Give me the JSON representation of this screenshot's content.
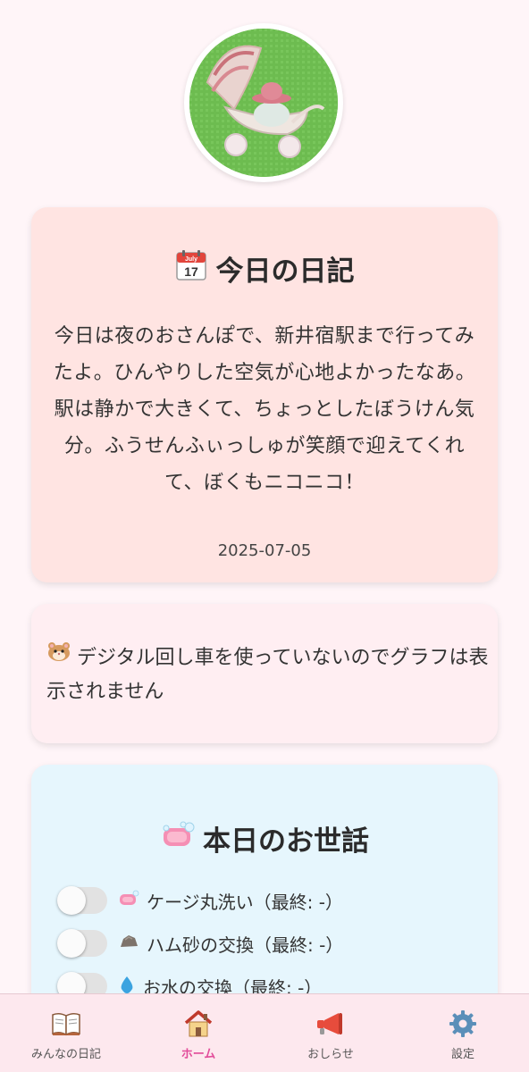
{
  "diary": {
    "title": "今日の日記",
    "calendar_icon": "calendar-icon",
    "calendar_month": "July",
    "calendar_day": "17",
    "body": "今日は夜のおさんぽで、新井宿駅まで行ってみたよ。ひんやりした空気が心地よかったなあ。駅は静かで大きくて、ちょっとしたぼうけん気分。ふうせんふぃっしゅが笑顔で迎えてくれて、ぼくもニコニコ！",
    "date": "2025-07-05"
  },
  "graph": {
    "icon": "hamster-icon",
    "message": "デジタル回し車を使っていないのでグラフは表示されません"
  },
  "care": {
    "title": "本日のお世話",
    "icon": "soap-icon",
    "items": [
      {
        "icon": "soap-icon",
        "label": "ケージ丸洗い（最終: -）",
        "checked": false
      },
      {
        "icon": "rock-icon",
        "label": "ハム砂の交換（最終: -）",
        "checked": false
      },
      {
        "icon": "water-drop-icon",
        "label": "お水の交換（最終: -）",
        "checked": false
      }
    ]
  },
  "nav": {
    "items": [
      {
        "label": "みんなの日記",
        "icon": "book-icon",
        "active": false
      },
      {
        "label": "ホーム",
        "icon": "house-icon",
        "active": true
      },
      {
        "label": "おしらせ",
        "icon": "megaphone-icon",
        "active": false
      },
      {
        "label": "設定",
        "icon": "gear-icon",
        "active": false
      }
    ]
  },
  "colors": {
    "active_nav": "#e24c9a",
    "diary_card": "#ffe4e2",
    "graph_card": "#ffeef2",
    "care_card": "#e6f6fd",
    "nav_bar": "#fde8ee"
  }
}
